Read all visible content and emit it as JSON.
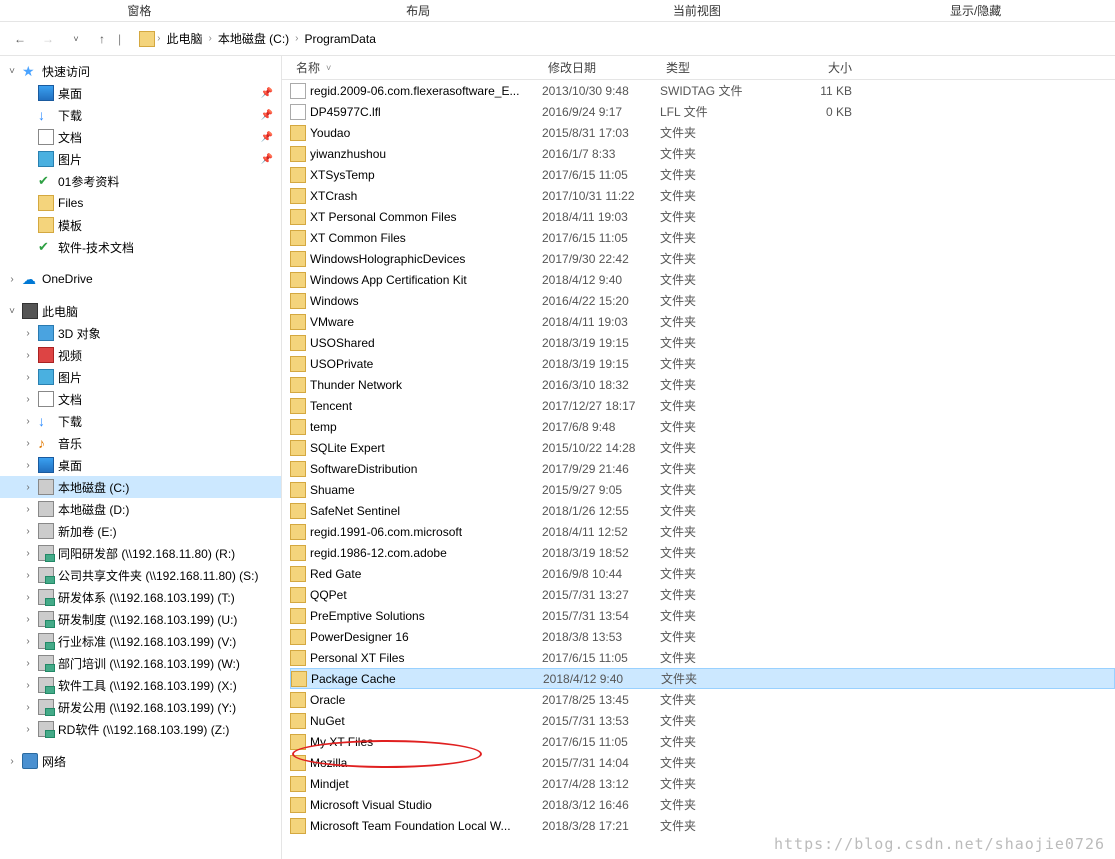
{
  "ribbon": {
    "tabs": [
      "窗格",
      "布局",
      "当前视图",
      "显示/隐藏"
    ]
  },
  "breadcrumb": {
    "parts": [
      "此电脑",
      "本地磁盘 (C:)",
      "ProgramData"
    ]
  },
  "columns": {
    "name": "名称",
    "date": "修改日期",
    "type": "类型",
    "size": "大小"
  },
  "sidebar": {
    "quick_access": "快速访问",
    "quick_items": [
      {
        "label": "桌面",
        "icon": "ico-desktop",
        "pinned": true
      },
      {
        "label": "下载",
        "icon": "ico-download",
        "pinned": true
      },
      {
        "label": "文档",
        "icon": "ico-doc",
        "pinned": true
      },
      {
        "label": "图片",
        "icon": "ico-pic",
        "pinned": true
      },
      {
        "label": "01参考资料",
        "icon": "ico-check",
        "pinned": false
      },
      {
        "label": "Files",
        "icon": "ico-folder",
        "pinned": false
      },
      {
        "label": "模板",
        "icon": "ico-folder",
        "pinned": false
      },
      {
        "label": "软件-技术文档",
        "icon": "ico-check",
        "pinned": false
      }
    ],
    "onedrive": "OneDrive",
    "this_pc": "此电脑",
    "pc_items": [
      {
        "label": "3D 对象",
        "icon": "ico-3d"
      },
      {
        "label": "视频",
        "icon": "ico-video"
      },
      {
        "label": "图片",
        "icon": "ico-pic"
      },
      {
        "label": "文档",
        "icon": "ico-doc"
      },
      {
        "label": "下载",
        "icon": "ico-download"
      },
      {
        "label": "音乐",
        "icon": "ico-music"
      },
      {
        "label": "桌面",
        "icon": "ico-desktop"
      },
      {
        "label": "本地磁盘 (C:)",
        "icon": "ico-drive",
        "selected": true
      },
      {
        "label": "本地磁盘 (D:)",
        "icon": "ico-drive"
      },
      {
        "label": "新加卷 (E:)",
        "icon": "ico-drive"
      },
      {
        "label": "同阳研发部 (\\\\192.168.11.80) (R:)",
        "icon": "ico-drive net"
      },
      {
        "label": "公司共享文件夹 (\\\\192.168.11.80) (S:)",
        "icon": "ico-drive net"
      },
      {
        "label": "研发体系 (\\\\192.168.103.199) (T:)",
        "icon": "ico-drive net"
      },
      {
        "label": "研发制度 (\\\\192.168.103.199) (U:)",
        "icon": "ico-drive net"
      },
      {
        "label": "行业标准 (\\\\192.168.103.199) (V:)",
        "icon": "ico-drive net"
      },
      {
        "label": "部门培训 (\\\\192.168.103.199) (W:)",
        "icon": "ico-drive net"
      },
      {
        "label": "软件工具 (\\\\192.168.103.199) (X:)",
        "icon": "ico-drive net"
      },
      {
        "label": "研发公用 (\\\\192.168.103.199) (Y:)",
        "icon": "ico-drive net"
      },
      {
        "label": "RD软件 (\\\\192.168.103.199) (Z:)",
        "icon": "ico-drive net"
      }
    ],
    "network": "网络"
  },
  "files": [
    {
      "name": "regid.2009-06.com.flexerasoftware_E...",
      "date": "2013/10/30 9:48",
      "type": "SWIDTAG 文件",
      "size": "11 KB",
      "icon": "ico-file"
    },
    {
      "name": "DP45977C.lfl",
      "date": "2016/9/24 9:17",
      "type": "LFL 文件",
      "size": "0 KB",
      "icon": "ico-file"
    },
    {
      "name": "Youdao",
      "date": "2015/8/31 17:03",
      "type": "文件夹",
      "size": "",
      "icon": "ico-folder"
    },
    {
      "name": "yiwanzhushou",
      "date": "2016/1/7 8:33",
      "type": "文件夹",
      "size": "",
      "icon": "ico-folder"
    },
    {
      "name": "XTSysTemp",
      "date": "2017/6/15 11:05",
      "type": "文件夹",
      "size": "",
      "icon": "ico-folder"
    },
    {
      "name": "XTCrash",
      "date": "2017/10/31 11:22",
      "type": "文件夹",
      "size": "",
      "icon": "ico-folder"
    },
    {
      "name": "XT Personal Common Files",
      "date": "2018/4/11 19:03",
      "type": "文件夹",
      "size": "",
      "icon": "ico-folder"
    },
    {
      "name": "XT Common Files",
      "date": "2017/6/15 11:05",
      "type": "文件夹",
      "size": "",
      "icon": "ico-folder"
    },
    {
      "name": "WindowsHolographicDevices",
      "date": "2017/9/30 22:42",
      "type": "文件夹",
      "size": "",
      "icon": "ico-folder"
    },
    {
      "name": "Windows App Certification Kit",
      "date": "2018/4/12 9:40",
      "type": "文件夹",
      "size": "",
      "icon": "ico-folder"
    },
    {
      "name": "Windows",
      "date": "2016/4/22 15:20",
      "type": "文件夹",
      "size": "",
      "icon": "ico-folder"
    },
    {
      "name": "VMware",
      "date": "2018/4/11 19:03",
      "type": "文件夹",
      "size": "",
      "icon": "ico-folder"
    },
    {
      "name": "USOShared",
      "date": "2018/3/19 19:15",
      "type": "文件夹",
      "size": "",
      "icon": "ico-folder"
    },
    {
      "name": "USOPrivate",
      "date": "2018/3/19 19:15",
      "type": "文件夹",
      "size": "",
      "icon": "ico-folder"
    },
    {
      "name": "Thunder Network",
      "date": "2016/3/10 18:32",
      "type": "文件夹",
      "size": "",
      "icon": "ico-folder"
    },
    {
      "name": "Tencent",
      "date": "2017/12/27 18:17",
      "type": "文件夹",
      "size": "",
      "icon": "ico-folder"
    },
    {
      "name": "temp",
      "date": "2017/6/8 9:48",
      "type": "文件夹",
      "size": "",
      "icon": "ico-folder"
    },
    {
      "name": "SQLite Expert",
      "date": "2015/10/22 14:28",
      "type": "文件夹",
      "size": "",
      "icon": "ico-folder"
    },
    {
      "name": "SoftwareDistribution",
      "date": "2017/9/29 21:46",
      "type": "文件夹",
      "size": "",
      "icon": "ico-folder"
    },
    {
      "name": "Shuame",
      "date": "2015/9/27 9:05",
      "type": "文件夹",
      "size": "",
      "icon": "ico-folder"
    },
    {
      "name": "SafeNet Sentinel",
      "date": "2018/1/26 12:55",
      "type": "文件夹",
      "size": "",
      "icon": "ico-folder"
    },
    {
      "name": "regid.1991-06.com.microsoft",
      "date": "2018/4/11 12:52",
      "type": "文件夹",
      "size": "",
      "icon": "ico-folder"
    },
    {
      "name": "regid.1986-12.com.adobe",
      "date": "2018/3/19 18:52",
      "type": "文件夹",
      "size": "",
      "icon": "ico-folder"
    },
    {
      "name": "Red Gate",
      "date": "2016/9/8 10:44",
      "type": "文件夹",
      "size": "",
      "icon": "ico-folder"
    },
    {
      "name": "QQPet",
      "date": "2015/7/31 13:27",
      "type": "文件夹",
      "size": "",
      "icon": "ico-folder"
    },
    {
      "name": "PreEmptive Solutions",
      "date": "2015/7/31 13:54",
      "type": "文件夹",
      "size": "",
      "icon": "ico-folder"
    },
    {
      "name": "PowerDesigner 16",
      "date": "2018/3/8 13:53",
      "type": "文件夹",
      "size": "",
      "icon": "ico-folder"
    },
    {
      "name": "Personal XT Files",
      "date": "2017/6/15 11:05",
      "type": "文件夹",
      "size": "",
      "icon": "ico-folder"
    },
    {
      "name": "Package Cache",
      "date": "2018/4/12 9:40",
      "type": "文件夹",
      "size": "",
      "icon": "ico-folder",
      "selected": true
    },
    {
      "name": "Oracle",
      "date": "2017/8/25 13:45",
      "type": "文件夹",
      "size": "",
      "icon": "ico-folder"
    },
    {
      "name": "NuGet",
      "date": "2015/7/31 13:53",
      "type": "文件夹",
      "size": "",
      "icon": "ico-folder"
    },
    {
      "name": "My XT Files",
      "date": "2017/6/15 11:05",
      "type": "文件夹",
      "size": "",
      "icon": "ico-folder"
    },
    {
      "name": "Mozilla",
      "date": "2015/7/31 14:04",
      "type": "文件夹",
      "size": "",
      "icon": "ico-folder"
    },
    {
      "name": "Mindjet",
      "date": "2017/4/28 13:12",
      "type": "文件夹",
      "size": "",
      "icon": "ico-folder"
    },
    {
      "name": "Microsoft Visual Studio",
      "date": "2018/3/12 16:46",
      "type": "文件夹",
      "size": "",
      "icon": "ico-folder"
    },
    {
      "name": "Microsoft Team Foundation Local W...",
      "date": "2018/3/28 17:21",
      "type": "文件夹",
      "size": "",
      "icon": "ico-folder"
    }
  ],
  "watermark": "https://blog.csdn.net/shaojie0726"
}
